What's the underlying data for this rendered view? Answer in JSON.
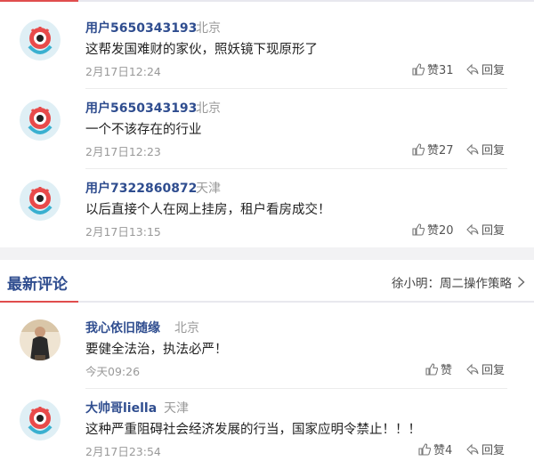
{
  "hot_comments": [
    {
      "user": "用户5650343193",
      "location": "北京",
      "text": "这帮发国难财的家伙，照妖镜下现原形了",
      "time": "2月17日12:24",
      "like_label": "赞31",
      "reply_label": "回复",
      "avatar": "weibo-default-avatar"
    },
    {
      "user": "用户5650343193",
      "location": "北京",
      "text": "一个不该存在的行业",
      "time": "2月17日12:23",
      "like_label": "赞27",
      "reply_label": "回复",
      "avatar": "weibo-default-avatar"
    },
    {
      "user": "用户7322860872",
      "location": "天津",
      "text": "以后直接个人在网上挂房，租户看房成交！",
      "time": "2月17日13:15",
      "like_label": "赞20",
      "reply_label": "回复",
      "avatar": "weibo-default-avatar"
    }
  ],
  "latest_section": {
    "title": "最新评论",
    "promo": "徐小明：周二操作策略"
  },
  "latest_comments": [
    {
      "user": "我心依旧随缘",
      "location": "北京",
      "text": "要健全法治，执法必严！",
      "time": "今天09:26",
      "like_label": "赞",
      "reply_label": "回复",
      "avatar": "user-photo-avatar"
    },
    {
      "user": "大帅哥liella",
      "location": "天津",
      "text": "这种严重阻碍社会经济发展的行当，国家应明令禁止！！！",
      "time": "2月17日23:54",
      "like_label": "赞4",
      "reply_label": "回复",
      "avatar": "weibo-default-avatar"
    }
  ],
  "colors": {
    "username": "#2f4d8f",
    "accent_red": "#e04d4d",
    "muted": "#999999"
  }
}
